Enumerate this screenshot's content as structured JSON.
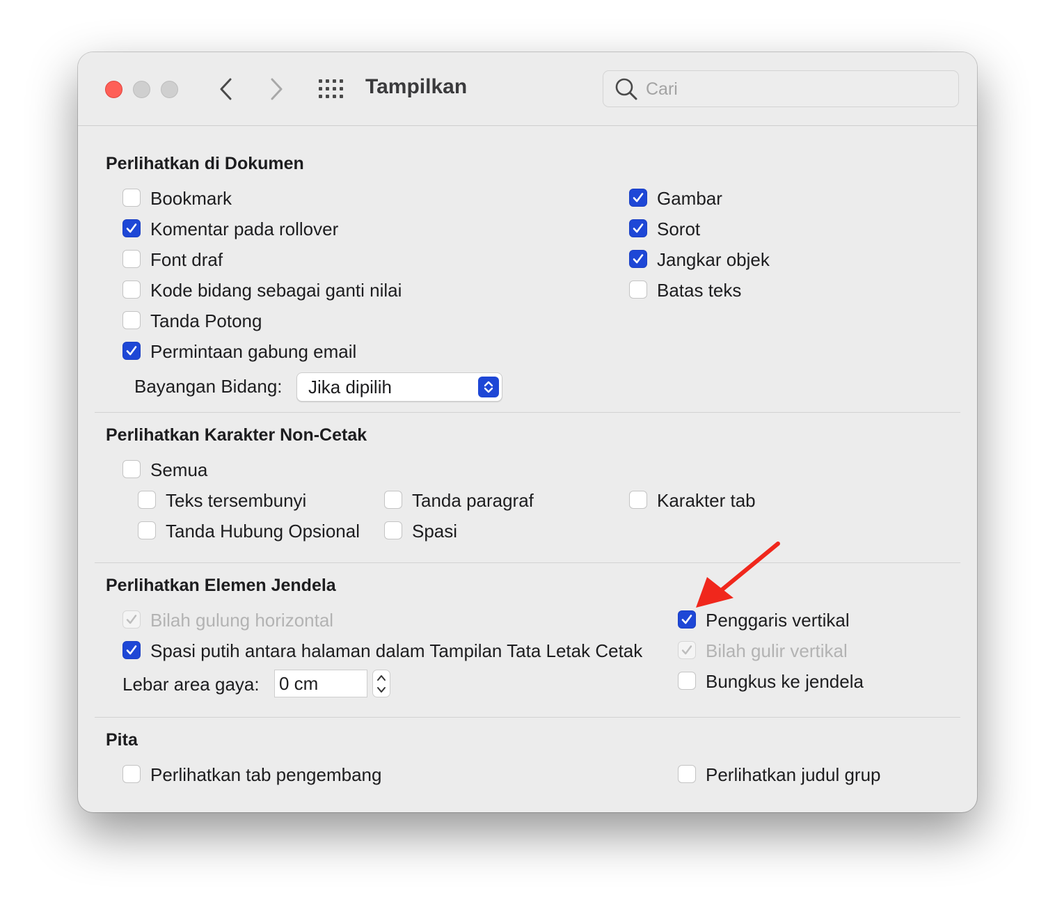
{
  "window": {
    "title": "Tampilkan",
    "search": {
      "placeholder": "Cari"
    }
  },
  "sections": {
    "documents": {
      "title": "Perlihatkan di Dokumen",
      "left": [
        {
          "label": "Bookmark",
          "checked": false
        },
        {
          "label": "Komentar pada rollover",
          "checked": true
        },
        {
          "label": "Font draf",
          "checked": false
        },
        {
          "label": "Kode bidang sebagai ganti nilai",
          "checked": false
        },
        {
          "label": "Tanda Potong",
          "checked": false
        },
        {
          "label": "Permintaan gabung email",
          "checked": true
        }
      ],
      "right": [
        {
          "label": "Gambar",
          "checked": true
        },
        {
          "label": "Sorot",
          "checked": true
        },
        {
          "label": "Jangkar objek",
          "checked": true
        },
        {
          "label": "Batas teks",
          "checked": false
        }
      ],
      "field_shading": {
        "label": "Bayangan Bidang:",
        "value": "Jika dipilih"
      }
    },
    "nonprinting": {
      "title": "Perlihatkan Karakter Non-Cetak",
      "all": {
        "label": "Semua",
        "checked": false
      },
      "items": [
        {
          "label": "Teks tersembunyi",
          "checked": false
        },
        {
          "label": "Tanda paragraf",
          "checked": false
        },
        {
          "label": "Karakter tab",
          "checked": false
        },
        {
          "label": "Tanda Hubung Opsional",
          "checked": false
        },
        {
          "label": "Spasi",
          "checked": false
        }
      ]
    },
    "window_elements": {
      "title": "Perlihatkan Elemen Jendela",
      "left": [
        {
          "label": "Bilah gulung horizontal",
          "checked": true,
          "disabled": true
        },
        {
          "label": "Spasi putih antara halaman dalam Tampilan Tata Letak Cetak",
          "checked": true,
          "disabled": false
        }
      ],
      "right": [
        {
          "label": "Penggaris vertikal",
          "checked": true,
          "disabled": false
        },
        {
          "label": "Bilah gulir vertikal",
          "checked": true,
          "disabled": true
        },
        {
          "label": "Bungkus ke jendela",
          "checked": false,
          "disabled": false
        }
      ],
      "style_area": {
        "label": "Lebar area gaya:",
        "value": "0 cm"
      }
    },
    "ribbon": {
      "title": "Pita",
      "items": [
        {
          "label": "Perlihatkan tab pengembang",
          "checked": false
        },
        {
          "label": "Perlihatkan judul grup",
          "checked": false
        }
      ]
    }
  },
  "colors": {
    "accent": "#1e47d6",
    "annotation_arrow": "#f0271c",
    "close_button": "#fe5f57"
  }
}
